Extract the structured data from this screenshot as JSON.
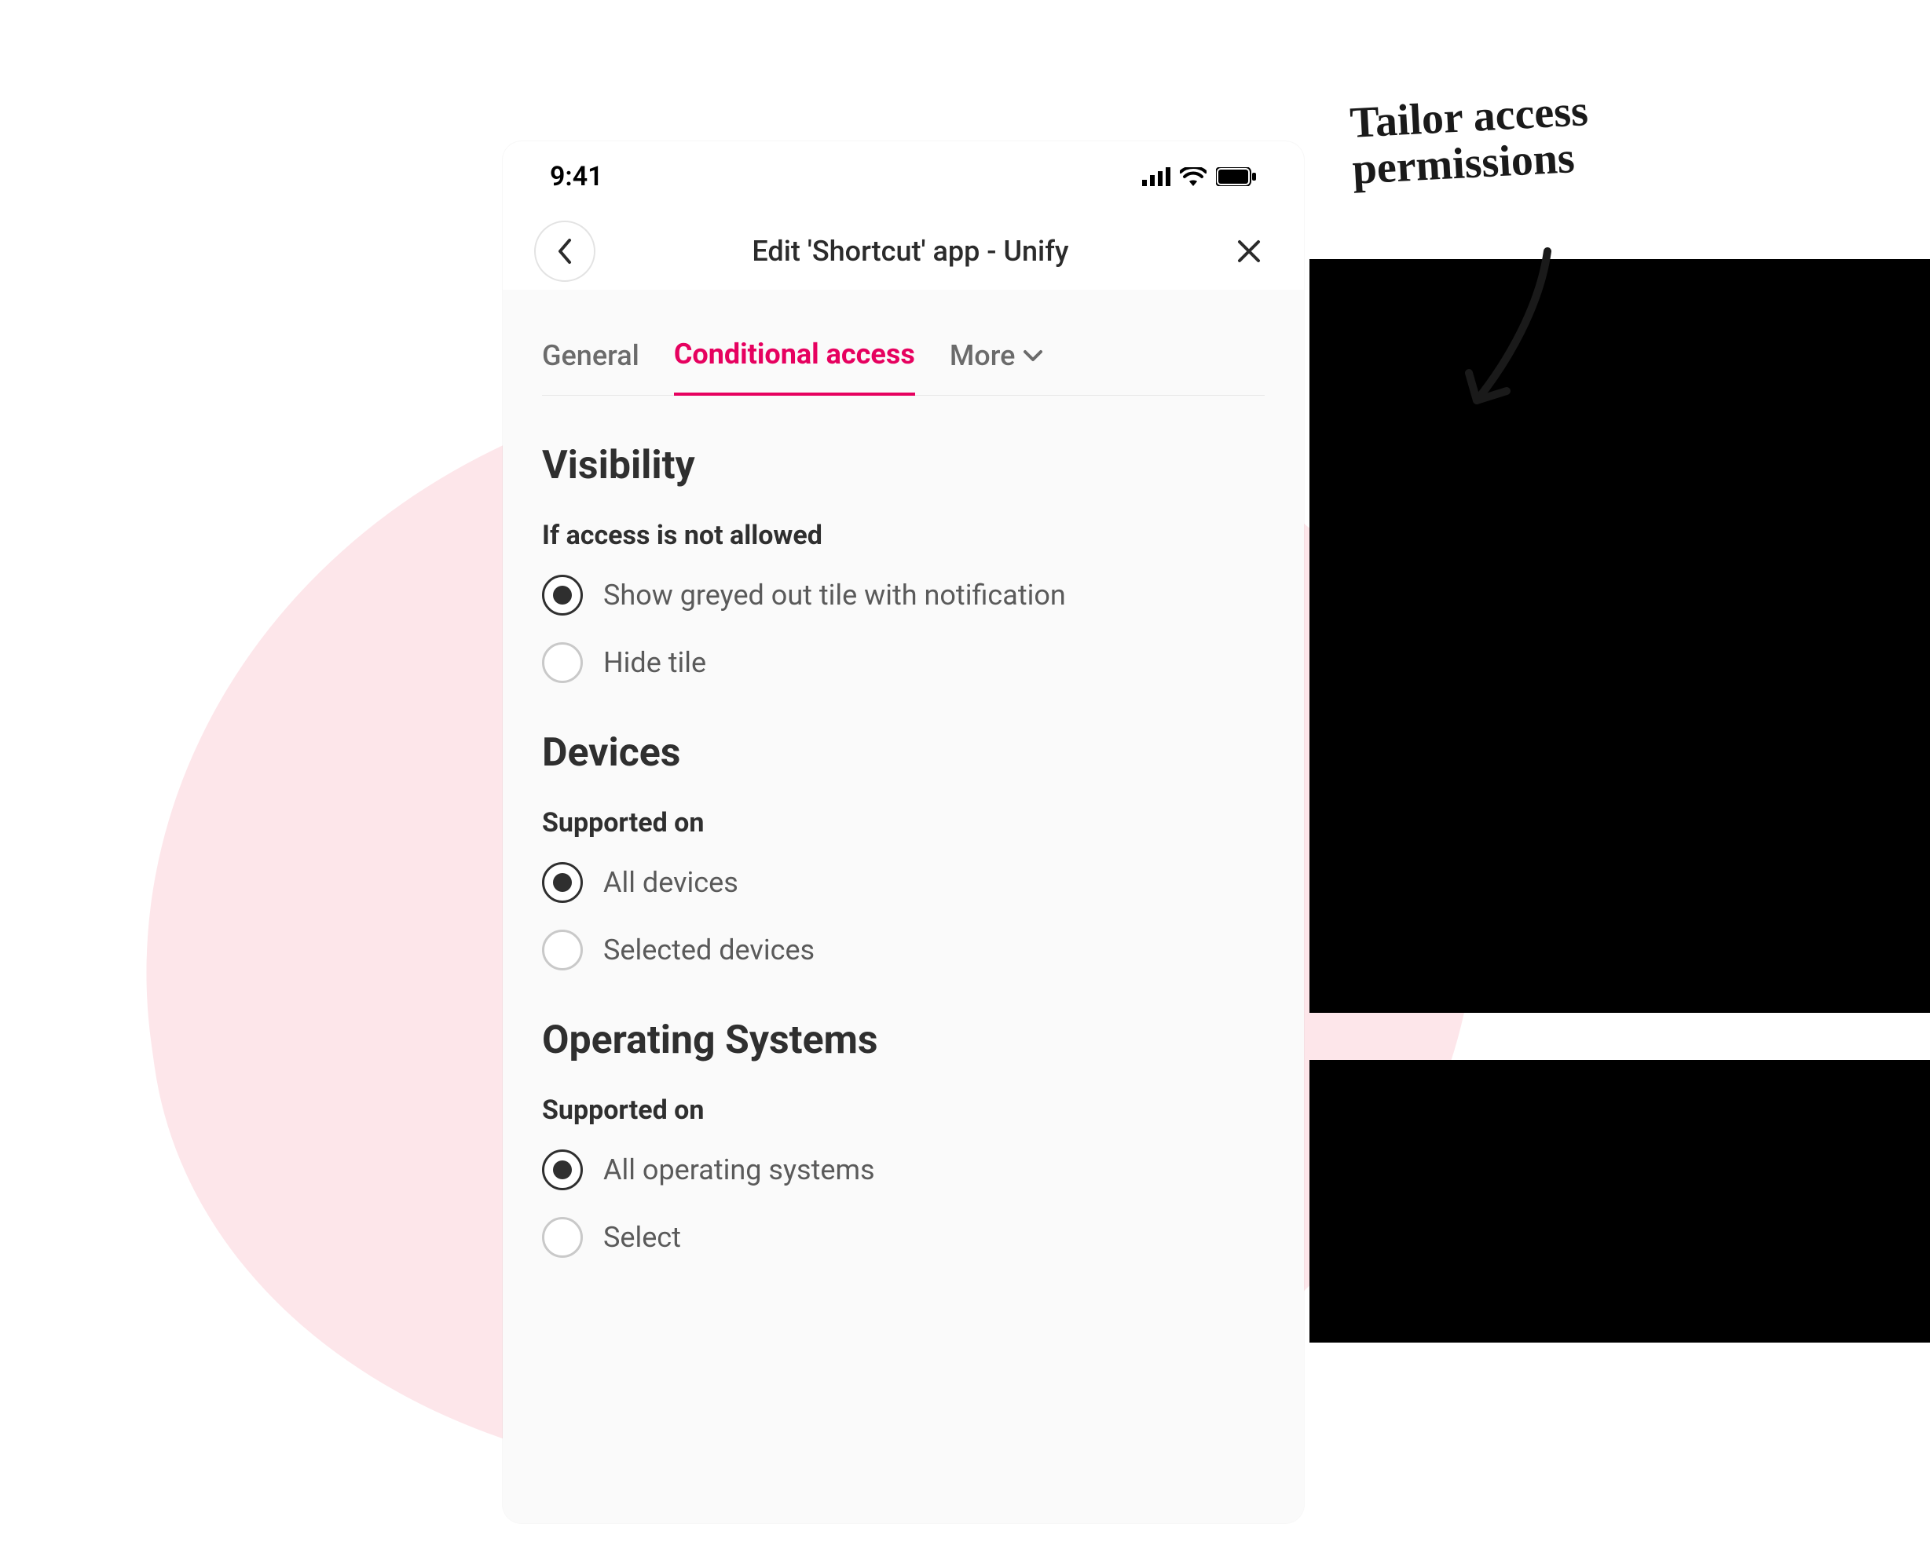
{
  "statusBar": {
    "time": "9:41"
  },
  "header": {
    "title": "Edit 'Shortcut' app - Unify"
  },
  "tabs": {
    "general": "General",
    "conditional": "Conditional access",
    "more": "More"
  },
  "visibility": {
    "heading": "Visibility",
    "subhead": "If access is not allowed",
    "opt1": "Show greyed out tile with notification",
    "opt2": "Hide tile"
  },
  "devices": {
    "heading": "Devices",
    "subhead": "Supported on",
    "opt1": "All devices",
    "opt2": "Selected devices"
  },
  "os": {
    "heading": "Operating Systems",
    "subhead": "Supported on",
    "opt1": "All operating systems",
    "opt2": "Select"
  },
  "annotation": "Tailor access\npermissions"
}
